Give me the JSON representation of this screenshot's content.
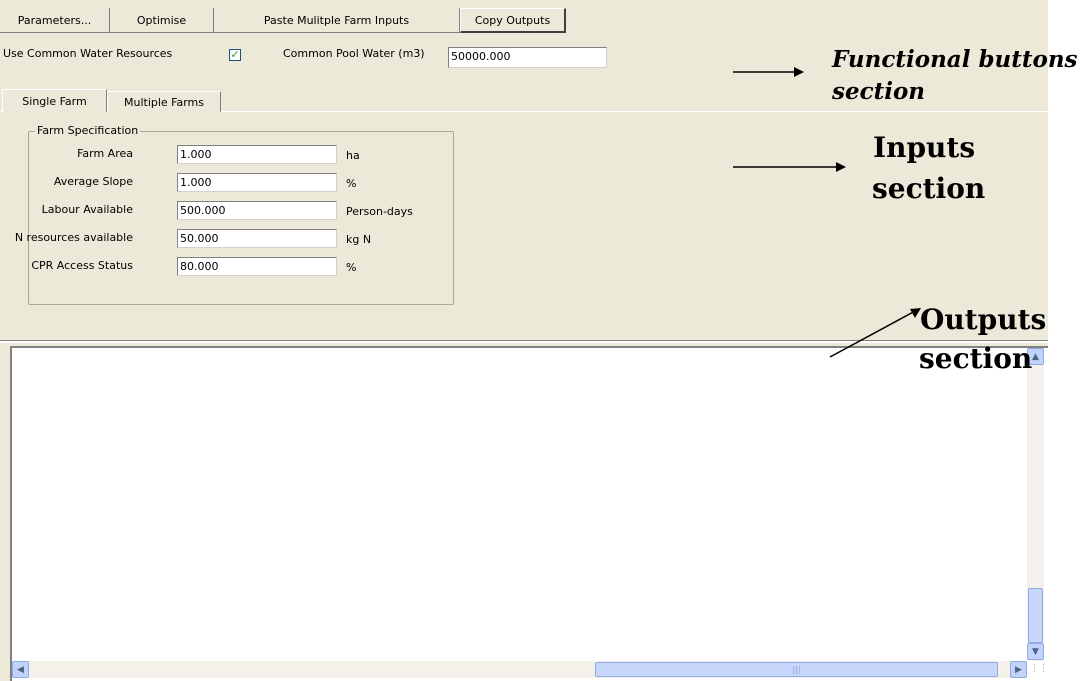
{
  "toolbar": {
    "parameters_label": "Parameters...",
    "optimise_label": "Optimise",
    "paste_label": "Paste Mulitple Farm Inputs",
    "copy_label": "Copy Outputs"
  },
  "water": {
    "use_common_label": "Use Common Water Resources",
    "use_common_checked": "✓",
    "pool_label": "Common Pool Water (m3)",
    "pool_value": "50000.000"
  },
  "tabs": [
    {
      "label": "Single Farm",
      "active": true
    },
    {
      "label": "Multiple Farms",
      "active": false
    }
  ],
  "farm_spec": {
    "title": "Farm Specification",
    "fields": [
      {
        "label": "Farm Area",
        "value": "1.000",
        "unit": "ha"
      },
      {
        "label": "Average Slope",
        "value": "1.000",
        "unit": "%"
      },
      {
        "label": "Labour Available",
        "value": "500.000",
        "unit": "Person-days"
      },
      {
        "label": "N resources available",
        "value": "50.000",
        "unit": "kg N"
      },
      {
        "label": "CPR Access Status",
        "value": "80.000",
        "unit": "%"
      }
    ]
  },
  "annotations": {
    "functional_line1": "Functional buttons",
    "functional_line2": "section",
    "inputs_line1": "Inputs",
    "inputs_line2": "section",
    "outputs_line1": "Outputs",
    "outputs_line2": "section"
  }
}
